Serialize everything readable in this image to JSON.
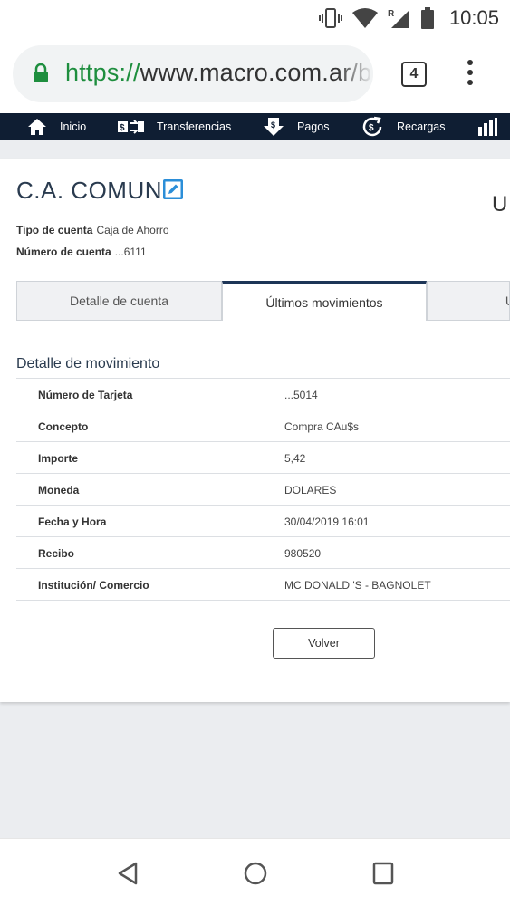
{
  "status_bar": {
    "time": "10:05",
    "icons": [
      "vibrate-icon",
      "wifi-icon",
      "signal-roaming-icon",
      "battery-icon"
    ],
    "roaming_mark": "R"
  },
  "browser": {
    "url_scheme": "https://",
    "url_rest": "www.macro.com.ar/b",
    "tab_count": "4",
    "url_scheme_color": "#1e8e3e"
  },
  "site_nav": {
    "items": [
      {
        "label": "Inicio",
        "icon": "home-icon"
      },
      {
        "label": "Transferencias",
        "icon": "transfer-icon"
      },
      {
        "label": "Pagos",
        "icon": "payments-icon"
      },
      {
        "label": "Recargas",
        "icon": "recharge-icon"
      },
      {
        "label": "",
        "icon": "chart-icon"
      }
    ],
    "background": "#0f1e33"
  },
  "account": {
    "title": "C.A. COMUN",
    "right_cut_text": "U",
    "type_label": "Tipo de cuenta",
    "type_value": "Caja de Ahorro",
    "number_label": "Número de cuenta",
    "number_value": "...6111"
  },
  "tabs": [
    {
      "label": "Detalle de cuenta",
      "active": false
    },
    {
      "label": "Últimos movimientos",
      "active": true
    },
    {
      "label": "U",
      "active": false
    }
  ],
  "detail": {
    "title": "Detalle de movimiento",
    "rows": [
      {
        "label": "Número de Tarjeta",
        "value": "...5014"
      },
      {
        "label": "Concepto",
        "value": "Compra CAu$s"
      },
      {
        "label": "Importe",
        "value": "5,42"
      },
      {
        "label": "Moneda",
        "value": "DOLARES"
      },
      {
        "label": "Fecha y Hora",
        "value": "30/04/2019 16:01"
      },
      {
        "label": "Recibo",
        "value": "980520"
      },
      {
        "label": "Institución/ Comercio",
        "value": "MC DONALD 'S - BAGNOLET"
      }
    ],
    "back_button": "Volver"
  },
  "system_nav": {
    "buttons": [
      "back-icon",
      "home-circle-icon",
      "recents-icon"
    ]
  }
}
